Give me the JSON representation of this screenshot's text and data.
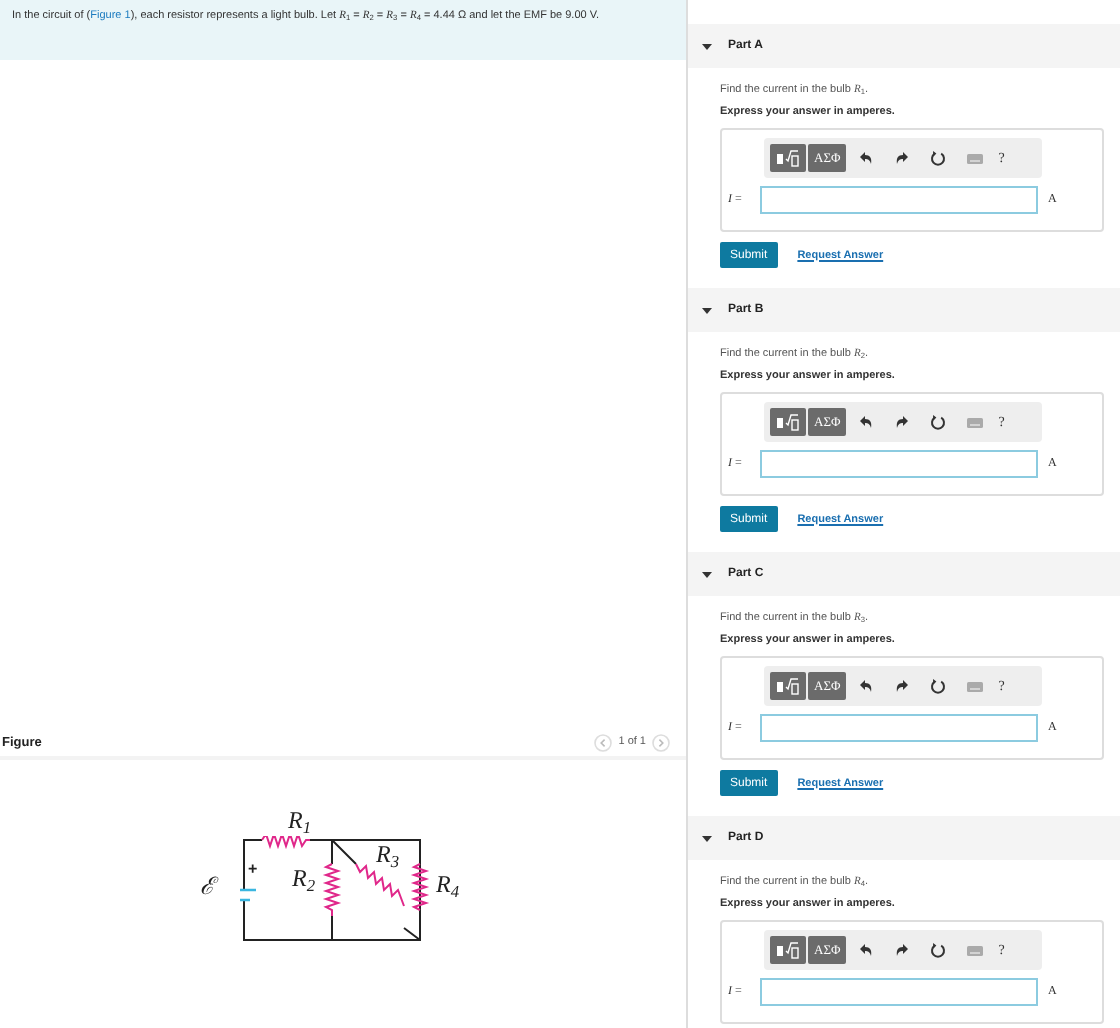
{
  "problem": {
    "before": "In the circuit of (",
    "link": "Figure 1",
    "after": "), each resistor represents a light bulb. Let *R*$_{1}$ = *R*$_{2}$ = *R*$_{3}$ = *R*$_{4}$ = 4.44 Ω and let the EMF be 9.00 V."
  },
  "figure": {
    "title": "Figure",
    "pager": "1 of 1",
    "labels": [
      "*R*$_{1}$",
      "ℰ",
      "*R*$_{2}$",
      "*R*$_{3}$",
      "*R*$_{4}$",
      "+"
    ]
  },
  "parts": [
    {
      "title": "Part A",
      "expanded": true,
      "question": "Find the current in the bulb *R*$_{1}$.",
      "instruction": "Express your answer in amperes.",
      "symbols": "ΑΣΦ",
      "help": "?",
      "variable": "*I* =",
      "unit": "A",
      "submit": "Submit",
      "request": "Request Answer"
    },
    {
      "title": "Part B",
      "expanded": true,
      "question": "Find the current in the bulb *R*$_{2}$.",
      "instruction": "Express your answer in amperes.",
      "symbols": "ΑΣΦ",
      "help": "?",
      "variable": "*I* =",
      "unit": "A",
      "submit": "Submit",
      "request": "Request Answer"
    },
    {
      "title": "Part C",
      "expanded": true,
      "question": "Find the current in the bulb *R*$_{3}$.",
      "instruction": "Express your answer in amperes.",
      "symbols": "ΑΣΦ",
      "help": "?",
      "variable": "*I* =",
      "unit": "A",
      "submit": "Submit",
      "request": "Request Answer"
    },
    {
      "title": "Part D",
      "expanded": true,
      "question": "Find the current in the bulb *R*$_{4}$.",
      "instruction": "Express your answer in amperes.",
      "symbols": "ΑΣΦ",
      "help": "?",
      "variable": "*I* =",
      "unit": "A"
    }
  ]
}
